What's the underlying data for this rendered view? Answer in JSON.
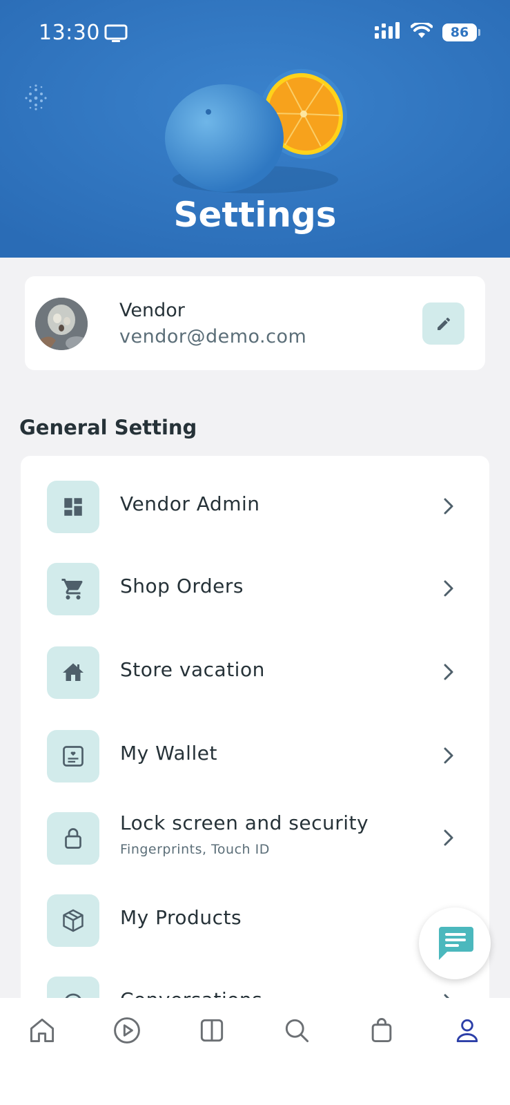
{
  "status_bar": {
    "time": "13:30",
    "battery": "86",
    "icons": [
      "screen-mirroring-icon",
      "cellular-signal-icon",
      "wifi-icon",
      "battery-icon"
    ]
  },
  "header": {
    "title": "Settings",
    "background_color": "#2f74c0"
  },
  "profile": {
    "name": "Vendor",
    "email": "vendor@demo.com"
  },
  "general": {
    "title": "General Setting",
    "items": [
      {
        "label": "Vendor Admin",
        "subtitle": "",
        "icon": "dashboard-icon"
      },
      {
        "label": "Shop Orders",
        "subtitle": "",
        "icon": "cart-icon"
      },
      {
        "label": "Store vacation",
        "subtitle": "",
        "icon": "home-icon"
      },
      {
        "label": "My Wallet",
        "subtitle": "",
        "icon": "wallet-icon"
      },
      {
        "label": "Lock screen and security",
        "subtitle": "Fingerprints, Touch ID",
        "icon": "lock-icon"
      },
      {
        "label": "My Products",
        "subtitle": "",
        "icon": "box-icon"
      },
      {
        "label": "Conversations",
        "subtitle": "",
        "icon": "chat-icon"
      }
    ]
  },
  "bottom_nav": {
    "items": [
      "home-icon",
      "play-icon",
      "layout-icon",
      "search-icon",
      "bag-icon",
      "profile-icon"
    ],
    "active": "profile-icon"
  },
  "colors": {
    "accent": "#2f74c0",
    "icon_bg": "#d2ebeb",
    "icon_fg": "#4e5f6a",
    "fab_icon": "#4bb8bd",
    "nav_active": "#2c3fa8"
  }
}
